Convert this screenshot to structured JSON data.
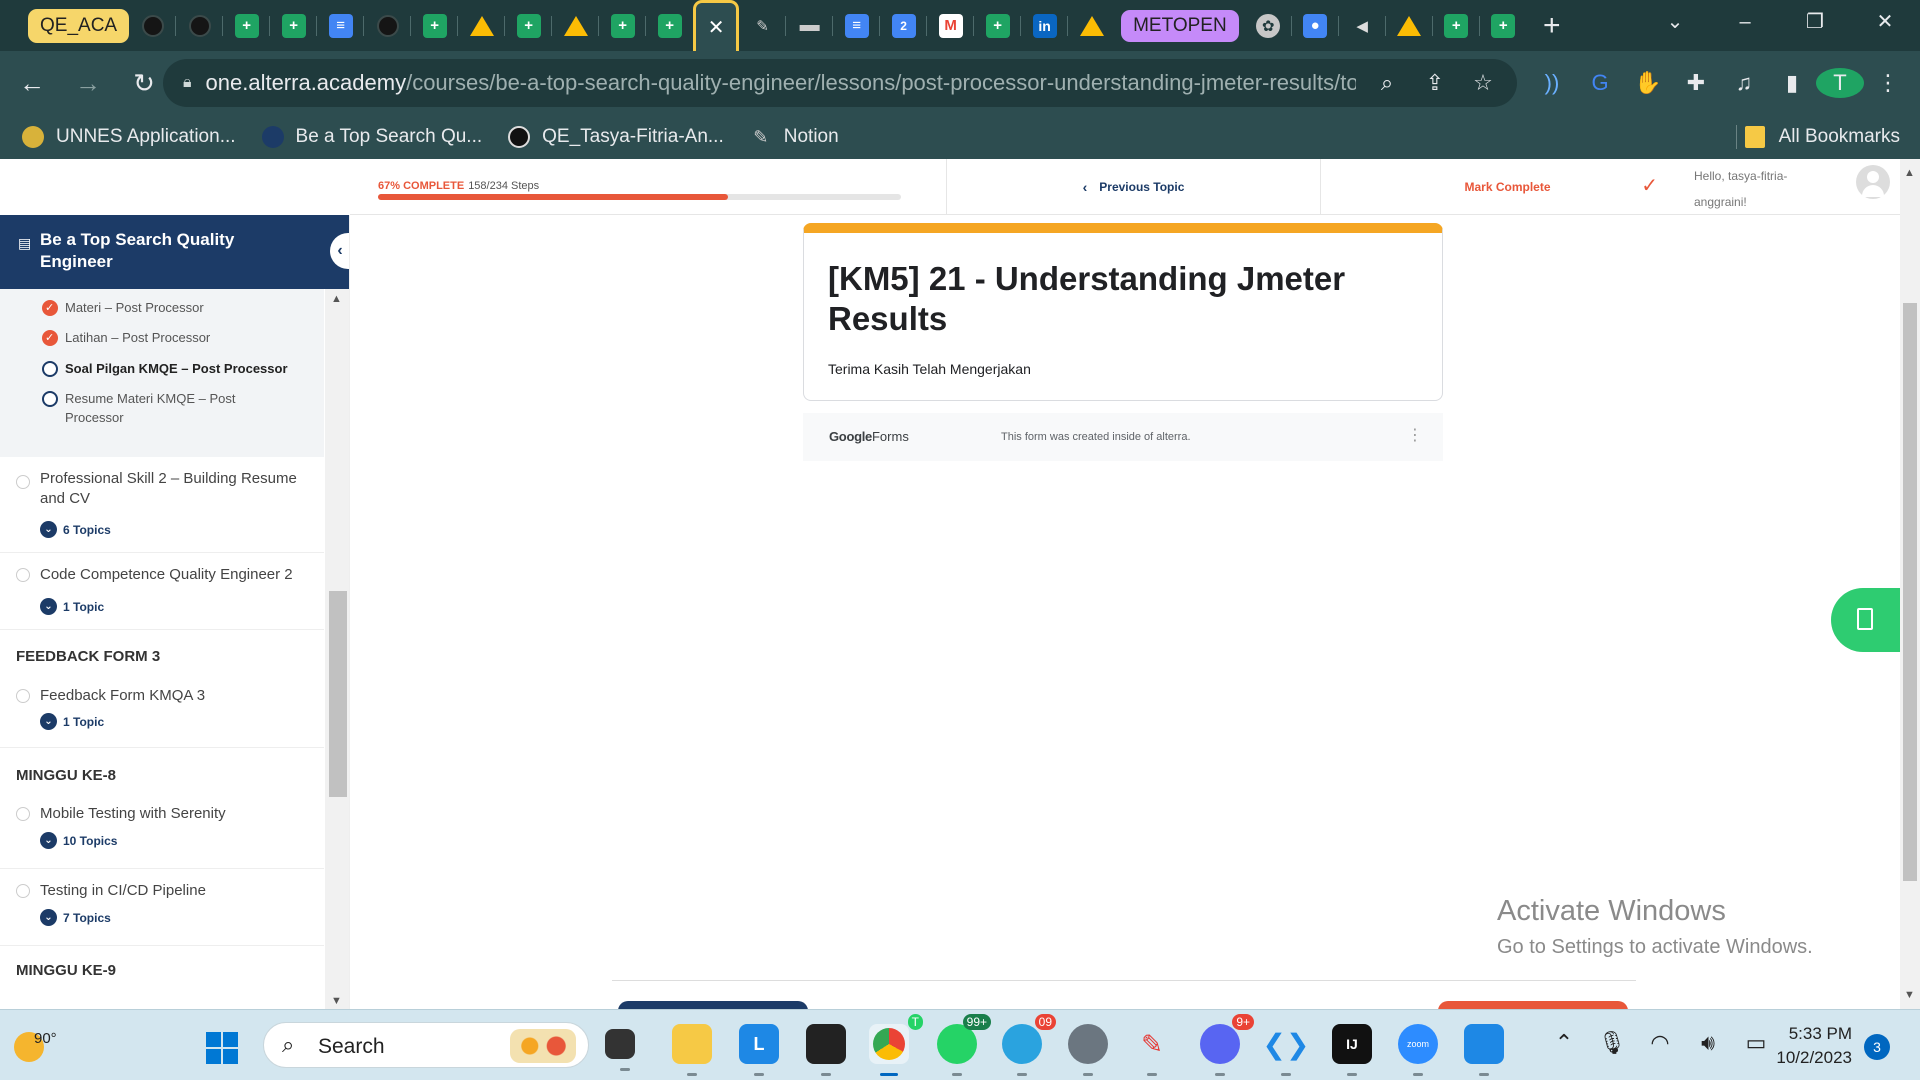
{
  "browser": {
    "tab_group_label": "QE_ACA",
    "tab_favicons": [
      "github",
      "github",
      "sheets",
      "sheets",
      "docs",
      "github",
      "sheets",
      "drive",
      "sheets",
      "drive",
      "sheets",
      "sheets"
    ],
    "active_tab_icon": "close-icon",
    "tab_favicons_after_active": [
      "tool",
      "bar",
      "docs",
      "calendar",
      "gmail",
      "sheets",
      "linkedin",
      "drive"
    ],
    "tab_group2_label": "METOPEN",
    "tab_favicons_end": [
      "chatgpt",
      "contacts",
      "audio",
      "drive",
      "sheets",
      "sheets"
    ],
    "calendar_day": "2",
    "linkedin_text": "in",
    "url_host": "one.alterra.academy",
    "url_path": "/courses/be-a-top-search-quality-engineer/lessons/post-processor-understanding-jmeter-results/topi...",
    "profile_initial": "T",
    "bookmarks": [
      {
        "label": "UNNES Application..."
      },
      {
        "label": "Be a Top Search Qu..."
      },
      {
        "label": "QE_Tasya-Fitria-An..."
      },
      {
        "label": "Notion"
      }
    ],
    "all_bookmarks": "All Bookmarks"
  },
  "topbar": {
    "progress_percent_label": "67% COMPLETE",
    "progress_steps": "158/234 Steps",
    "progress_fraction": 0.67,
    "previous_topic": "Previous Topic",
    "mark_complete": "Mark Complete",
    "greeting": "Hello, tasya-fitria-anggraini!"
  },
  "sidebar": {
    "course_title": "Be a Top Search Quality Engineer",
    "topics": [
      {
        "label": "Materi – Post Processor",
        "status": "done"
      },
      {
        "label": "Latihan – Post Processor",
        "status": "done"
      },
      {
        "label": "Soal Pilgan KMQE – Post Processor",
        "status": "current"
      },
      {
        "label": "Resume Materi KMQE – Post Processor",
        "status": "open"
      }
    ],
    "lessons": [
      {
        "title": "Professional Skill 2 – Building Resume and CV",
        "count": "6 Topics"
      },
      {
        "title": "Code Competence Quality Engineer 2",
        "count": "1 Topic"
      }
    ],
    "section_feedback": "FEEDBACK FORM 3",
    "lesson_feedback": {
      "title": "Feedback Form KMQA 3",
      "count": "1 Topic"
    },
    "section_week8": "MINGGU KE-8",
    "lessons_week8": [
      {
        "title": "Mobile Testing with Serenity",
        "count": "10 Topics"
      },
      {
        "title": "Testing in CI/CD Pipeline",
        "count": "7 Topics"
      }
    ],
    "section_week9": "MINGGU KE-9"
  },
  "form": {
    "title": "[KM5] 21 - Understanding Jmeter Results",
    "message": "Terima Kasih Telah Mengerjakan",
    "brand_google": "Google",
    "brand_forms": "Forms",
    "created_note": "This form was created inside of alterra."
  },
  "watermark": {
    "line1": "Activate Windows",
    "line2": "Go to Settings to activate Windows."
  },
  "taskbar": {
    "temperature": "90°",
    "search_label": "Search",
    "whatsapp_badge": "99+",
    "telegram_badge": "09",
    "discord_badge": "9+",
    "chrome_badge": "T",
    "time": "5:33 PM",
    "date": "10/2/2023",
    "notifications": "3",
    "zoom_label": "zoom"
  }
}
